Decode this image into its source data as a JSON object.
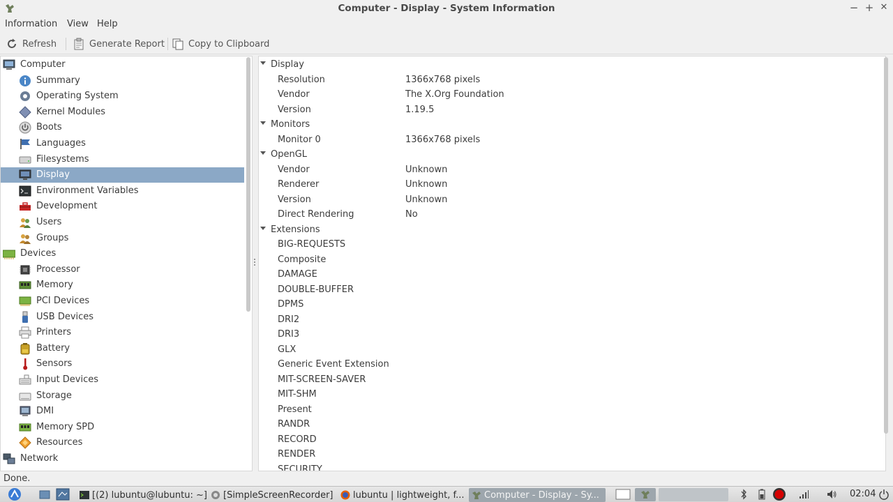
{
  "window": {
    "title": "Computer - Display - System Information",
    "minimize": "−",
    "maximize": "+",
    "close": "✕"
  },
  "menu": [
    "Information",
    "View",
    "Help"
  ],
  "toolbar": {
    "refresh": "Refresh",
    "generate_report": "Generate Report",
    "copy_clipboard": "Copy to Clipboard"
  },
  "sidebar": {
    "selected": "Display",
    "items": [
      {
        "label": "Computer",
        "level": 0,
        "icon": "computer-icon"
      },
      {
        "label": "Summary",
        "level": 1,
        "icon": "info-icon"
      },
      {
        "label": "Operating System",
        "level": 1,
        "icon": "gear-icon"
      },
      {
        "label": "Kernel Modules",
        "level": 1,
        "icon": "module-icon"
      },
      {
        "label": "Boots",
        "level": 1,
        "icon": "power-icon"
      },
      {
        "label": "Languages",
        "level": 1,
        "icon": "flag-icon"
      },
      {
        "label": "Filesystems",
        "level": 1,
        "icon": "drive-icon"
      },
      {
        "label": "Display",
        "level": 1,
        "icon": "monitor-icon"
      },
      {
        "label": "Environment Variables",
        "level": 1,
        "icon": "terminal-icon"
      },
      {
        "label": "Development",
        "level": 1,
        "icon": "toolbox-icon"
      },
      {
        "label": "Users",
        "level": 1,
        "icon": "users-icon"
      },
      {
        "label": "Groups",
        "level": 1,
        "icon": "group-icon"
      },
      {
        "label": "Devices",
        "level": 0,
        "icon": "devices-icon"
      },
      {
        "label": "Processor",
        "level": 1,
        "icon": "cpu-icon"
      },
      {
        "label": "Memory",
        "level": 1,
        "icon": "memory-icon"
      },
      {
        "label": "PCI Devices",
        "level": 1,
        "icon": "pci-icon"
      },
      {
        "label": "USB Devices",
        "level": 1,
        "icon": "usb-icon"
      },
      {
        "label": "Printers",
        "level": 1,
        "icon": "printer-icon"
      },
      {
        "label": "Battery",
        "level": 1,
        "icon": "battery-icon"
      },
      {
        "label": "Sensors",
        "level": 1,
        "icon": "thermometer-icon"
      },
      {
        "label": "Input Devices",
        "level": 1,
        "icon": "keyboard-icon"
      },
      {
        "label": "Storage",
        "level": 1,
        "icon": "storage-icon"
      },
      {
        "label": "DMI",
        "level": 1,
        "icon": "dmi-icon"
      },
      {
        "label": "Memory SPD",
        "level": 1,
        "icon": "memory-spd-icon"
      },
      {
        "label": "Resources",
        "level": 1,
        "icon": "resources-icon"
      },
      {
        "label": "Network",
        "level": 0,
        "icon": "network-icon"
      }
    ]
  },
  "content": {
    "rows": [
      {
        "type": "section",
        "label": "Display"
      },
      {
        "type": "kv",
        "key": "Resolution",
        "value": "1366x768 pixels"
      },
      {
        "type": "kv",
        "key": "Vendor",
        "value": "The X.Org Foundation"
      },
      {
        "type": "kv",
        "key": "Version",
        "value": "1.19.5"
      },
      {
        "type": "section",
        "label": "Monitors"
      },
      {
        "type": "kv",
        "key": "Monitor 0",
        "value": "1366x768 pixels"
      },
      {
        "type": "section",
        "label": "OpenGL"
      },
      {
        "type": "kv",
        "key": "Vendor",
        "value": "Unknown"
      },
      {
        "type": "kv",
        "key": "Renderer",
        "value": "Unknown"
      },
      {
        "type": "kv",
        "key": "Version",
        "value": "Unknown"
      },
      {
        "type": "kv",
        "key": "Direct Rendering",
        "value": "No"
      },
      {
        "type": "section",
        "label": "Extensions"
      },
      {
        "type": "kv",
        "key": "BIG-REQUESTS",
        "value": ""
      },
      {
        "type": "kv",
        "key": "Composite",
        "value": ""
      },
      {
        "type": "kv",
        "key": "DAMAGE",
        "value": ""
      },
      {
        "type": "kv",
        "key": "DOUBLE-BUFFER",
        "value": ""
      },
      {
        "type": "kv",
        "key": "DPMS",
        "value": ""
      },
      {
        "type": "kv",
        "key": "DRI2",
        "value": ""
      },
      {
        "type": "kv",
        "key": "DRI3",
        "value": ""
      },
      {
        "type": "kv",
        "key": "GLX",
        "value": ""
      },
      {
        "type": "kv",
        "key": "Generic Event Extension",
        "value": ""
      },
      {
        "type": "kv",
        "key": "MIT-SCREEN-SAVER",
        "value": ""
      },
      {
        "type": "kv",
        "key": "MIT-SHM",
        "value": ""
      },
      {
        "type": "kv",
        "key": "Present",
        "value": ""
      },
      {
        "type": "kv",
        "key": "RANDR",
        "value": ""
      },
      {
        "type": "kv",
        "key": "RECORD",
        "value": ""
      },
      {
        "type": "kv",
        "key": "RENDER",
        "value": ""
      },
      {
        "type": "kv",
        "key": "SECURITY",
        "value": ""
      }
    ]
  },
  "status": "Done.",
  "taskbar": {
    "tasks": [
      {
        "label": "[(2) lubuntu@lubuntu: ~]",
        "icon": "terminal-icon"
      },
      {
        "label": "[SimpleScreenRecorder]",
        "icon": "recorder-icon"
      },
      {
        "label": "lubuntu | lightweight, f...",
        "icon": "firefox-icon"
      },
      {
        "label": "Computer - Display - Sy...",
        "icon": "hardinfo-icon"
      }
    ],
    "clock": "02:04"
  },
  "colors": {
    "selection": "#8ba8c6",
    "active_task": "#9da6ad"
  }
}
